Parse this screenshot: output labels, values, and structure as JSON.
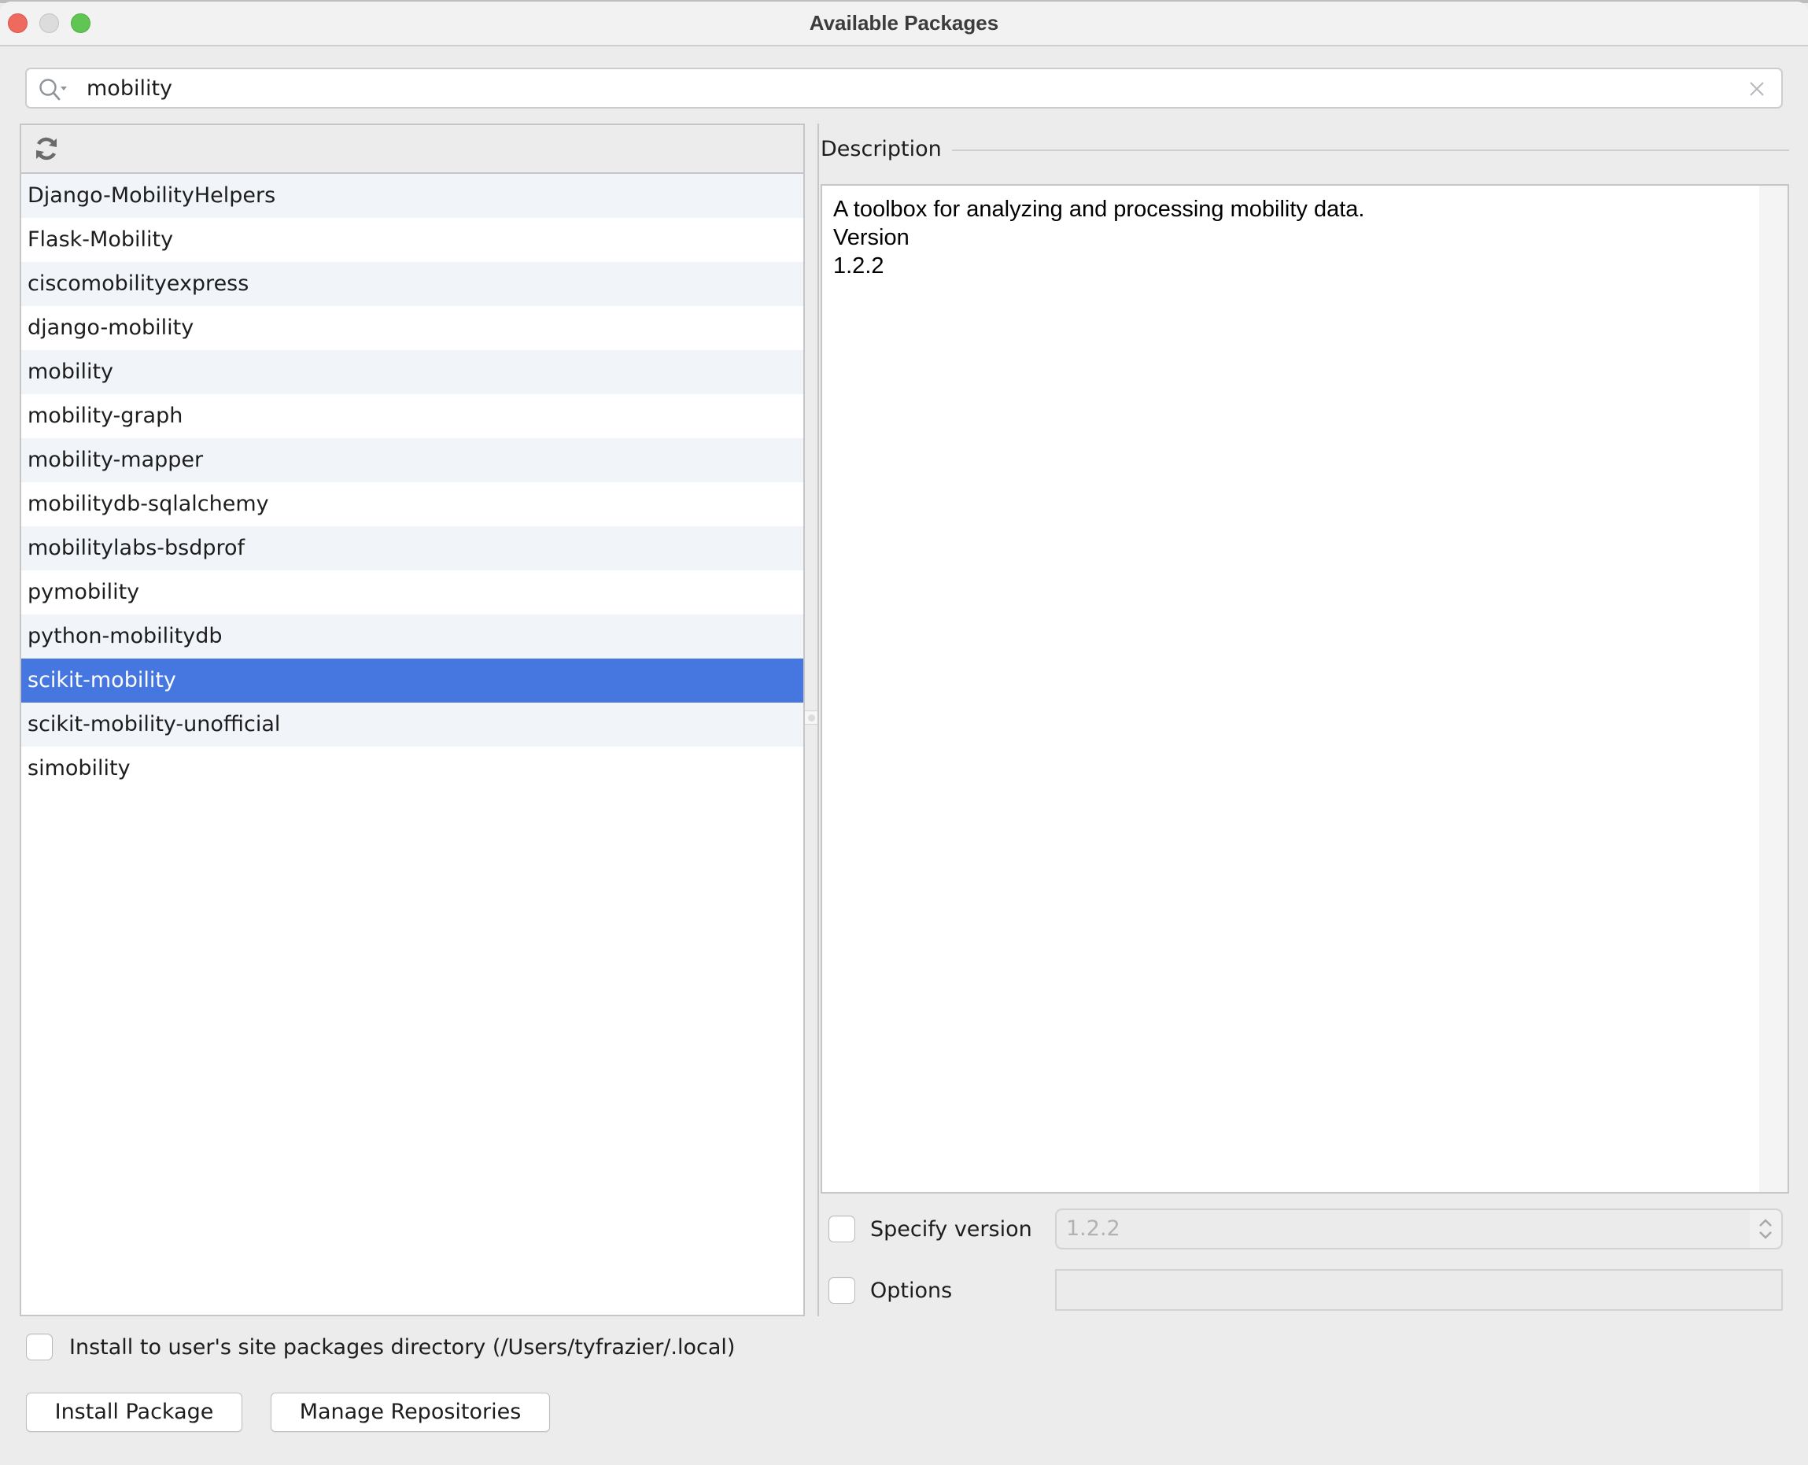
{
  "window": {
    "title": "Available Packages",
    "controls": [
      "close",
      "minimize",
      "maximize"
    ]
  },
  "search": {
    "value": "mobility",
    "icon": "search-icon",
    "clear_icon": "close-icon"
  },
  "list_toolbar": {
    "refresh_icon": "refresh-icon"
  },
  "packages": [
    "Django-MobilityHelpers",
    "Flask-Mobility",
    "ciscomobilityexpress",
    "django-mobility",
    "mobility",
    "mobility-graph",
    "mobility-mapper",
    "mobilitydb-sqlalchemy",
    "mobilitylabs-bsdprof",
    "pymobility",
    "python-mobilitydb",
    "scikit-mobility",
    "scikit-mobility-unofficial",
    "simobility"
  ],
  "selected_package": "scikit-mobility",
  "description": {
    "label": "Description",
    "lines": [
      "A toolbox for analyzing and processing mobility data.",
      "Version",
      "1.2.2"
    ]
  },
  "specify_version": {
    "label": "Specify version",
    "checked": false,
    "value": "1.2.2"
  },
  "options": {
    "label": "Options",
    "checked": false,
    "value": ""
  },
  "install_to_user": {
    "label": "Install to user's site packages directory (/Users/tyfrazier/.local)",
    "checked": false
  },
  "buttons": {
    "install": "Install Package",
    "manage": "Manage Repositories"
  },
  "colors": {
    "selection": "#4677e0",
    "row_alt": "#f1f4f9",
    "close": "#ee6a5f",
    "minimize": "#dcdcdc",
    "maximize": "#61c554"
  }
}
